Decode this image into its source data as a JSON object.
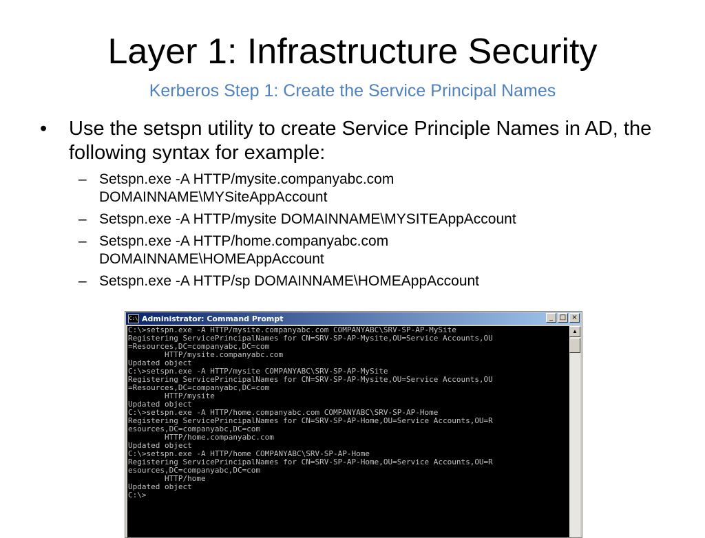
{
  "slide": {
    "title": "Layer 1: Infrastructure Security",
    "subtitle": "Kerberos Step 1: Create the Service Principal Names",
    "bullet": {
      "marker": "•",
      "text": "Use the setspn utility to create Service Principle Names in AD, the following syntax for example:"
    },
    "sub_marker": "–",
    "sub_items": [
      "Setspn.exe -A HTTP/mysite.companyabc.com DOMAINNAME\\MYSiteAppAccount",
      "Setspn.exe -A HTTP/mysite DOMAINNAME\\MYSITEAppAccount",
      "Setspn.exe -A HTTP/home.companyabc.com DOMAINNAME\\HOMEAppAccount",
      "Setspn.exe -A HTTP/sp DOMAINNAME\\HOMEAppAccount"
    ]
  },
  "cmd_window": {
    "title": "Administrator: Command Prompt",
    "icon_label": "C:\\",
    "minimize_glyph": "_",
    "maximize_glyph": "□",
    "close_glyph": "×",
    "scroll_up_glyph": "▲",
    "scroll_down_glyph": "▼",
    "lines": [
      "C:\\>setspn.exe -A HTTP/mysite.companyabc.com COMPANYABC\\SRV-SP-AP-MySite",
      "Registering ServicePrincipalNames for CN=SRV-SP-AP-Mysite,OU=Service Accounts,OU",
      "=Resources,DC=companyabc,DC=com",
      "        HTTP/mysite.companyabc.com",
      "Updated object",
      "",
      "C:\\>setspn.exe -A HTTP/mysite COMPANYABC\\SRV-SP-AP-MySite",
      "Registering ServicePrincipalNames for CN=SRV-SP-AP-Mysite,OU=Service Accounts,OU",
      "=Resources,DC=companyabc,DC=com",
      "        HTTP/mysite",
      "Updated object",
      "",
      "C:\\>setspn.exe -A HTTP/home.companyabc.com COMPANYABC\\SRV-SP-AP-Home",
      "Registering ServicePrincipalNames for CN=SRV-SP-AP-Home,OU=Service Accounts,OU=R",
      "esources,DC=companyabc,DC=com",
      "        HTTP/home.companyabc.com",
      "Updated object",
      "",
      "C:\\>setspn.exe -A HTTP/home COMPANYABC\\SRV-SP-AP-Home",
      "Registering ServicePrincipalNames for CN=SRV-SP-AP-Home,OU=Service Accounts,OU=R",
      "esources,DC=companyabc,DC=com",
      "        HTTP/home",
      "Updated object",
      "",
      "C:\\>"
    ]
  }
}
